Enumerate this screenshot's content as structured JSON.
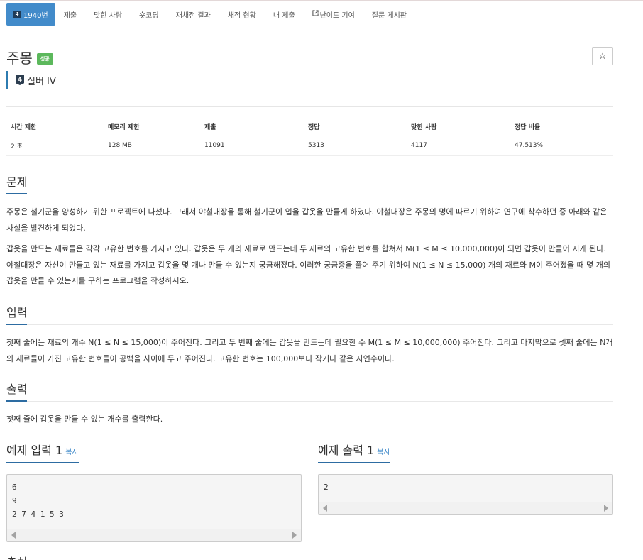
{
  "nav": {
    "tabs": [
      {
        "label": "1940번",
        "tier_num": "4"
      },
      {
        "label": "제출"
      },
      {
        "label": "맞힌 사람"
      },
      {
        "label": "숏코딩"
      },
      {
        "label": "재채점 결과"
      },
      {
        "label": "채점 현황"
      },
      {
        "label": "내 제출"
      },
      {
        "label": "난이도 기여",
        "icon": "external-link-icon"
      },
      {
        "label": "질문 게시판"
      }
    ]
  },
  "problem": {
    "title": "주몽",
    "status_badge": "성공",
    "star": "☆",
    "tier_num": "4",
    "tier_label": "실버 IV"
  },
  "info_table": {
    "headers": [
      "시간 제한",
      "메모리 제한",
      "제출",
      "정답",
      "맞힌 사람",
      "정답 비율"
    ],
    "values": [
      "2 초",
      "128 MB",
      "11091",
      "5313",
      "4117",
      "47.513%"
    ]
  },
  "sections": {
    "problem_heading": "문제",
    "problem_p1": "주몽은 철기군을 양성하기 위한 프로젝트에 나섰다. 그래서 야철대장을 통해 철기군이 입을 갑옷을 만들게 하였다. 야철대장은 주몽의 명에 따르기 위하여 연구에 착수하던 중 아래와 같은 사실을 발견하게 되었다.",
    "problem_p2": "갑옷을 만드는 재료들은 각각 고유한 번호를 가지고 있다. 갑옷은 두 개의 재료로 만드는데 두 재료의 고유한 번호를 합쳐서 M(1 ≤ M ≤ 10,000,000)이 되면 갑옷이 만들어 지게 된다. 야철대장은 자신이 만들고 있는 재료를 가지고 갑옷을 몇 개나 만들 수 있는지 궁금해졌다. 이러한 궁금증을 풀어 주기 위하여 N(1 ≤ N ≤ 15,000) 개의 재료와 M이 주어졌을 때 몇 개의 갑옷을 만들 수 있는지를 구하는 프로그램을 작성하시오.",
    "input_heading": "입력",
    "input_p": "첫째 줄에는 재료의 개수 N(1 ≤ N ≤ 15,000)이 주어진다. 그리고 두 번째 줄에는 갑옷을 만드는데 필요한 수 M(1 ≤ M ≤ 10,000,000) 주어진다. 그리고 마지막으로 셋째 줄에는 N개의 재료들이 가진 고유한 번호들이 공백을 사이에 두고 주어진다. 고유한 번호는 100,000보다 작거나 같은 자연수이다.",
    "output_heading": "출력",
    "output_p": "첫째 줄에 갑옷을 만들 수 있는 개수를 출력한다.",
    "next_heading": "출처"
  },
  "samples": {
    "input_title": "예제 입력 1",
    "output_title": "예제 출력 1",
    "copy_label": "복사",
    "input_text": "6\n9\n2 7 4 1 5 3",
    "output_text": "2"
  },
  "colors": {
    "active_tab": "#428bca",
    "success": "#5cb85c",
    "heading_underline": "#2d6ca2",
    "tier": "#2c3e50"
  }
}
